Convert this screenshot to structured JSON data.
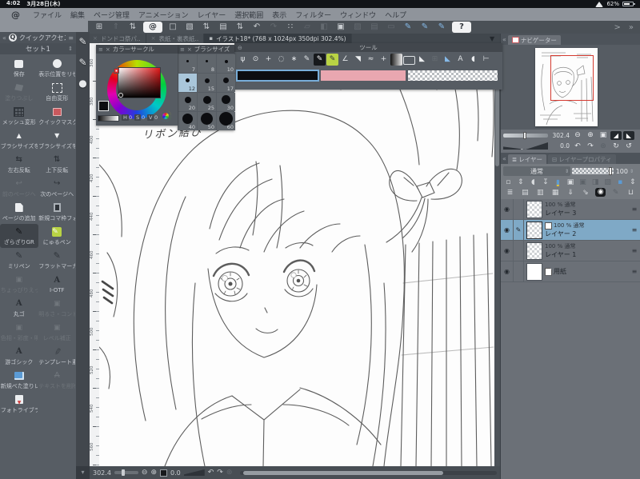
{
  "status_bar": {
    "time": "4:02",
    "date": "3月28日(木)",
    "battery_percent": "62%"
  },
  "menu": {
    "items": [
      "ファイル",
      "編集",
      "ページ管理",
      "アニメーション",
      "レイヤー",
      "選択範囲",
      "表示",
      "フィルター",
      "ウィンドウ",
      "ヘルプ"
    ]
  },
  "toolbar": {
    "icons": [
      {
        "name": "quick-access-grid-icon",
        "glyph": "⊞",
        "state": "normal"
      },
      {
        "name": "export-icon",
        "glyph": "⇑",
        "state": "disabled"
      },
      {
        "name": "export-stepper-icon",
        "glyph": "⇅",
        "state": "normal"
      },
      {
        "name": "csp-home-button",
        "glyph": "@",
        "state": "pill"
      },
      {
        "name": "new-canvas-icon",
        "glyph": "□",
        "state": "normal"
      },
      {
        "name": "open-file-icon",
        "glyph": "▧",
        "state": "normal"
      },
      {
        "name": "open-stepper-icon",
        "glyph": "⇅",
        "state": "normal"
      },
      {
        "name": "paper-icon",
        "glyph": "▤",
        "state": "normal"
      },
      {
        "name": "paper-stepper-icon",
        "glyph": "⇅",
        "state": "normal"
      },
      {
        "name": "undo-icon",
        "glyph": "↶",
        "state": "normal"
      },
      {
        "name": "redo-icon",
        "glyph": "↷",
        "state": "disabled"
      },
      {
        "name": "deselect-icon",
        "glyph": "∷",
        "state": "normal"
      },
      {
        "name": "transform-icon",
        "glyph": "▱",
        "state": "disabled"
      },
      {
        "name": "blend-icon",
        "glyph": "◧",
        "state": "disabled"
      },
      {
        "name": "crop-frame-icon",
        "glyph": "▣",
        "state": "normal"
      },
      {
        "name": "material-icon",
        "glyph": "▨",
        "state": "disabled"
      },
      {
        "name": "material-2-icon",
        "glyph": "▤",
        "state": "disabled"
      },
      {
        "name": "marquee-icon",
        "glyph": "▭",
        "state": "disabled"
      },
      {
        "name": "stylus-pen-icon",
        "glyph": "✎",
        "state": "blue"
      },
      {
        "name": "stylus-pen-2-icon",
        "glyph": "✎",
        "state": "blue"
      },
      {
        "name": "stylus-tap-icon",
        "glyph": "✎",
        "state": "blue"
      },
      {
        "name": "help-button",
        "glyph": "?",
        "state": "pill"
      }
    ],
    "overflow_prev": ">",
    "overflow_more": "»"
  },
  "doc_tabs": {
    "tabs": [
      {
        "label": "ドンドコ祭パ..",
        "marker": "×",
        "active": "false"
      },
      {
        "label": "表紙・裏表紙..",
        "marker": "×",
        "active": "false"
      },
      {
        "label": "イラスト18* (768 x 1024px 350dpi 302.4%)",
        "marker": "▪",
        "active": "true"
      }
    ],
    "overflow_glyph": "▼"
  },
  "quick_access": {
    "collapse_glyph": "«",
    "title": "クイックアクセス",
    "menu_glyph": "≡",
    "set_label": "セット1",
    "set_stepper_glyph": "⇕",
    "buttons": [
      {
        "label": "保存",
        "icon": "save-icon",
        "state": "normal"
      },
      {
        "label": "表示位置をリセ..",
        "icon": "reset-view-icon",
        "state": "normal"
      },
      {
        "label": "塗りつぶし",
        "icon": "bucket-icon",
        "state": "disabled"
      },
      {
        "label": "自由変形",
        "icon": "transform-icon",
        "state": "normal"
      },
      {
        "label": "メッシュ変形",
        "icon": "mesh-icon",
        "state": "normal"
      },
      {
        "label": "クイックマスク..",
        "icon": "mask-icon",
        "state": "normal"
      },
      {
        "label": "ブラシサイズを..",
        "icon": "size-up-icon",
        "state": "normal"
      },
      {
        "label": "ブラシサイズを..",
        "icon": "size-down-icon",
        "state": "normal"
      },
      {
        "label": "左右反転",
        "icon": "flip-h-icon",
        "state": "normal"
      },
      {
        "label": "上下反転",
        "icon": "flip-v-icon",
        "state": "normal"
      },
      {
        "label": "前のページへ",
        "icon": "prev-page-icon",
        "state": "disabled"
      },
      {
        "label": "次のページへ",
        "icon": "next-page-icon",
        "state": "normal"
      },
      {
        "label": "ページの追加",
        "icon": "add-page-icon",
        "state": "normal"
      },
      {
        "label": "新規コマ枠フォ..",
        "icon": "frame-icon",
        "state": "normal"
      },
      {
        "label": "ざらざりGR",
        "icon": "pen-dark-icon",
        "state": "active"
      },
      {
        "label": "にゅるペン",
        "icon": "pen-green-icon",
        "state": "normal"
      },
      {
        "label": "ミリペン",
        "icon": "pen-icon",
        "state": "normal"
      },
      {
        "label": "フラットマーカー",
        "icon": "pen-icon",
        "state": "normal"
      },
      {
        "label": "ちょっぴりえっ..",
        "icon": "adjust-icon",
        "state": "disabled"
      },
      {
        "label": "I-OTF",
        "icon": "font-icon",
        "state": "normal"
      },
      {
        "label": "丸ゴ",
        "icon": "font-icon",
        "state": "normal"
      },
      {
        "label": "明るさ・コント..",
        "icon": "adjust-icon",
        "state": "disabled"
      },
      {
        "label": "色相・彩度・明..",
        "icon": "adjust-icon",
        "state": "disabled"
      },
      {
        "label": "レベル補正",
        "icon": "adjust-icon",
        "state": "disabled"
      },
      {
        "label": "游ゴシック",
        "icon": "font-icon",
        "state": "normal"
      },
      {
        "label": "テンプレート素..",
        "icon": "feather-icon",
        "state": "normal"
      },
      {
        "label": "新規べた塗りレ..",
        "icon": "fill-layer-icon",
        "state": "normal"
      },
      {
        "label": "テキストを削除",
        "icon": "text-del-icon",
        "state": "disabled"
      },
      {
        "label": "フォトライブラ..",
        "icon": "photo-icon",
        "state": "normal"
      }
    ]
  },
  "edge_strip": {
    "icons": [
      {
        "name": "edge-pen-icon",
        "glyph": "✎"
      },
      {
        "name": "edge-pen-settings-icon",
        "glyph": "✎"
      },
      {
        "name": "edge-color-blob-icon",
        "glyph": "●"
      }
    ],
    "bottom_glyph": "▾"
  },
  "color_wheel": {
    "menu_glyph": "≡",
    "close_glyph": "×",
    "minimize_glyph": "—",
    "title": "カラーサークル",
    "h_label": "H",
    "h_value": "0",
    "s_label": "S",
    "s_value": "0",
    "v_label": "V",
    "v_value": "0",
    "main_color": "#0c0d10",
    "sub_color": "#e9a7b0"
  },
  "brush_size": {
    "menu_glyph": "≡",
    "close_glyph": "×",
    "minimize_glyph": "—",
    "title": "ブラシサイズ",
    "cells": [
      {
        "value": "7",
        "dot_style": "width:3px;height:3px",
        "selected": "false"
      },
      {
        "value": "8",
        "dot_style": "width:3px;height:3px",
        "selected": "false"
      },
      {
        "value": "10",
        "dot_style": "width:4px;height:4px",
        "selected": "false"
      },
      {
        "value": "12",
        "dot_style": "width:5px;height:5px",
        "selected": "true"
      },
      {
        "value": "15",
        "dot_style": "width:6px;height:6px",
        "selected": "false"
      },
      {
        "value": "17",
        "dot_style": "width:7px;height:7px",
        "selected": "false"
      },
      {
        "value": "20",
        "dot_style": "width:8px;height:8px",
        "selected": "false"
      },
      {
        "value": "25",
        "dot_style": "width:10px;height:10px",
        "selected": "false"
      },
      {
        "value": "30",
        "dot_style": "width:11px;height:11px",
        "selected": "false"
      },
      {
        "value": "40",
        "dot_style": "width:13px;height:13px",
        "selected": "false"
      },
      {
        "value": "50",
        "dot_style": "width:15px;height:15px",
        "selected": "false"
      },
      {
        "value": "60",
        "dot_style": "width:17px;height:17px",
        "selected": "false"
      }
    ]
  },
  "tool_panel": {
    "minimize_glyph": "⊖",
    "title": "ツール",
    "tools": [
      {
        "name": "pan-tool-icon",
        "glyph": "ψ",
        "state": "normal"
      },
      {
        "name": "rotate-view-tool-icon",
        "glyph": "⊙",
        "state": "normal"
      },
      {
        "name": "move-tool-icon",
        "glyph": "+",
        "state": "normal"
      },
      {
        "name": "lasso-tool-icon",
        "glyph": "◌",
        "state": "normal"
      },
      {
        "name": "auto-select-tool-icon",
        "glyph": "∗",
        "state": "normal"
      },
      {
        "name": "pencil-tool-icon",
        "glyph": "✎",
        "state": "normal"
      },
      {
        "name": "pen-tool-icon",
        "glyph": "✎",
        "state": "active-dark"
      },
      {
        "name": "marker-tool-icon",
        "glyph": "✎",
        "state": "active-green"
      },
      {
        "name": "brush-tool-icon",
        "glyph": "∠",
        "state": "normal"
      },
      {
        "name": "eraser-tool-icon",
        "glyph": "◥",
        "state": "light"
      },
      {
        "name": "airbrush-tool-icon",
        "glyph": "≈",
        "state": "normal"
      },
      {
        "name": "decoration-tool-icon",
        "glyph": "+",
        "state": "normal"
      },
      {
        "name": "gradient-tool-icon",
        "glyph": "",
        "state": "gradient"
      },
      {
        "name": "figure-tool-icon",
        "glyph": "",
        "state": "frame"
      },
      {
        "name": "fill-tool-icon",
        "glyph": "◣",
        "state": "light"
      },
      {
        "name": "grid-tool-icon",
        "glyph": "⊞",
        "state": "disabled"
      },
      {
        "name": "ruler-tool-icon",
        "glyph": "◣",
        "state": "blue"
      },
      {
        "name": "text-tool-icon",
        "glyph": "A",
        "state": "normal"
      },
      {
        "name": "balloon-tool-icon",
        "glyph": "◖",
        "state": "light"
      },
      {
        "name": "line-tool-icon",
        "glyph": "⊢",
        "state": "normal"
      }
    ],
    "main_color": "#0c0d10",
    "sub_color": "#e9a7b0"
  },
  "canvas": {
    "annotation": "リボン結び",
    "ruler_values": [
      "360",
      "380",
      "400",
      "420",
      "440",
      "460",
      "480",
      "500",
      "520",
      "540",
      "560"
    ]
  },
  "canvas_status": {
    "zoom_value": "302.4",
    "zoom_out_glyph": "⊖",
    "zoom_in_glyph": "⊕",
    "rotation_value": "0.0",
    "rotate_left_glyph": "↶",
    "rotate_right_glyph": "↷",
    "reset_glyph": "⊛"
  },
  "navigator": {
    "collapse_glyph": "«",
    "title": "ナビゲーター",
    "zoom_value": "302.4",
    "rotation_value": "0.0",
    "icons_row1": [
      {
        "name": "zoom-out-icon",
        "glyph": "⊖",
        "state": "normal",
        "boxy": ""
      },
      {
        "name": "zoom-in-icon",
        "glyph": "⊕",
        "state": "normal",
        "boxy": ""
      },
      {
        "name": "fit-to-screen-icon",
        "glyph": "▣",
        "state": "normal",
        "boxy": ""
      },
      {
        "name": "flip-horizontal-icon",
        "glyph": "◢",
        "state": "normal",
        "boxy": "boxy"
      },
      {
        "name": "flip-vertical-icon",
        "glyph": "◣",
        "state": "normal",
        "boxy": "boxy"
      }
    ],
    "icons_row2": [
      {
        "name": "rotate-left-icon",
        "glyph": "↶",
        "state": "normal",
        "boxy": ""
      },
      {
        "name": "rotate-right-icon",
        "glyph": "↷",
        "state": "normal",
        "boxy": ""
      },
      {
        "name": "reset-rotation-icon",
        "glyph": "⊛",
        "state": "disabled",
        "boxy": ""
      },
      {
        "name": "reset-view-icon",
        "glyph": "↻",
        "state": "normal",
        "boxy": ""
      },
      {
        "name": "reset-all-icon",
        "glyph": "↺",
        "state": "normal",
        "boxy": ""
      }
    ]
  },
  "layers": {
    "collapse_glyph": "«",
    "tabs": [
      {
        "label": "レイヤー",
        "glyph": "≣",
        "active": "true"
      },
      {
        "label": "レイヤープロパティ",
        "glyph": "⊟",
        "active": "false"
      }
    ],
    "blend_mode": "通常",
    "blend_stepper_glyph": "⇕",
    "opacity_value": "100",
    "opacity_stepper_glyph": "⇕",
    "toolbar_row1": [
      {
        "name": "thumbnail-size-icon",
        "glyph": "▫",
        "state": "normal"
      },
      {
        "name": "thumbnail-stepper-icon",
        "glyph": "⇕",
        "state": "normal"
      },
      {
        "name": "quick-mask-icon",
        "glyph": "◖",
        "state": "normal"
      },
      {
        "name": "clip-to-layer-icon",
        "glyph": "↧",
        "state": "normal"
      },
      {
        "name": "pin-icon",
        "glyph": "▮",
        "state": "pin"
      },
      {
        "name": "lock-layer-icon",
        "glyph": "▣",
        "state": "normal"
      },
      {
        "name": "lock-transparent-icon",
        "glyph": "▣",
        "state": "disabled"
      },
      {
        "name": "enable-mask-icon",
        "glyph": "◨",
        "state": "disabled"
      },
      {
        "name": "ruler-range-icon",
        "glyph": "▨",
        "state": "disabled"
      },
      {
        "name": "palette-color-icon",
        "glyph": "▪",
        "state": "blue"
      },
      {
        "name": "palette-stepper-icon",
        "glyph": "⇕",
        "state": "normal"
      }
    ],
    "toolbar_row2": [
      {
        "name": "layer-stack-icon",
        "glyph": "≣",
        "state": "normal"
      },
      {
        "name": "new-raster-layer-icon",
        "glyph": "▤",
        "state": "normal"
      },
      {
        "name": "new-vector-layer-icon",
        "glyph": "▥",
        "state": "normal"
      },
      {
        "name": "duplicate-layer-icon",
        "glyph": "▦",
        "state": "normal"
      },
      {
        "name": "merge-down-icon",
        "glyph": "⇓",
        "state": "normal"
      },
      {
        "name": "combine-icon",
        "glyph": "⇘",
        "state": "normal"
      },
      {
        "name": "layer-mask-icon",
        "glyph": "◉",
        "state": "mask"
      },
      {
        "name": "draft-layer-icon",
        "glyph": "✎",
        "state": "disabled"
      },
      {
        "name": "delete-layer-icon",
        "glyph": "⊔",
        "state": "normal"
      }
    ],
    "rows": [
      {
        "opacity_text": "100 % 通常",
        "name": "レイヤー 3",
        "thumb": "checker",
        "selected": "false",
        "editing": "false",
        "menu_glyph": "≡"
      },
      {
        "opacity_text": "100 % 通常",
        "name": "レイヤー 2",
        "thumb": "checker",
        "selected": "true",
        "editing": "true",
        "menu_glyph": "≡"
      },
      {
        "opacity_text": "100 % 通常",
        "name": "レイヤー 1",
        "thumb": "checker",
        "selected": "false",
        "editing": "false",
        "menu_glyph": "≡"
      },
      {
        "opacity_text": "",
        "name": "用紙",
        "thumb": "paper",
        "selected": "false",
        "editing": "false",
        "menu_glyph": "≡"
      }
    ]
  }
}
